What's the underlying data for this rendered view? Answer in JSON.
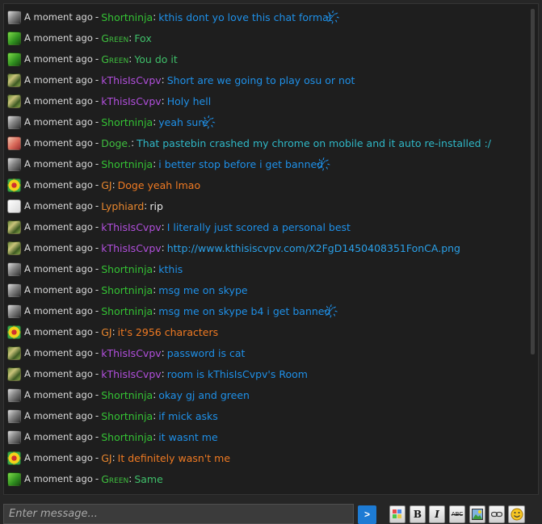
{
  "colors": {
    "timestamp": "#d9d9d9",
    "shortninja": "#34c234",
    "green": "#3fbf3f",
    "kthisiscvpv": "#b14fdc",
    "doge": "#3fbf3f",
    "gj": "#e8872e",
    "lyphiard": "#e8872e",
    "msg_blue": "#1e90e8",
    "msg_cyan": "#2fb7c6",
    "msg_green": "#3fbf6a",
    "msg_orange": "#f07a22",
    "msg_white": "#e8e8e8",
    "msg_link": "#2aa0e8"
  },
  "messages": [
    {
      "avatar": "gray",
      "time": "A moment ago",
      "user": "Shortninja",
      "smallcaps": false,
      "user_color": "#34c234",
      "text": "kthis dont yo love this chat format ̸҉",
      "text_color": "#1e90e8"
    },
    {
      "avatar": "green",
      "time": "A moment ago",
      "user": "Green",
      "smallcaps": true,
      "user_color": "#3fbf3f",
      "text": "Fox",
      "text_color": "#3fbf6a"
    },
    {
      "avatar": "green",
      "time": "A moment ago",
      "user": "Green",
      "smallcaps": true,
      "user_color": "#3fbf3f",
      "text": "You do it",
      "text_color": "#3fbf6a"
    },
    {
      "avatar": "camo",
      "time": "A moment ago",
      "user": "kThisIsCvpv",
      "smallcaps": false,
      "user_color": "#b14fdc",
      "text": "Short are we going to play osu or not",
      "text_color": "#1e90e8"
    },
    {
      "avatar": "camo",
      "time": "A moment ago",
      "user": "kThisIsCvpv",
      "smallcaps": false,
      "user_color": "#b14fdc",
      "text": "Holy hell",
      "text_color": "#1e90e8"
    },
    {
      "avatar": "gray",
      "time": "A moment ago",
      "user": "Shortninja",
      "smallcaps": false,
      "user_color": "#34c234",
      "text": "yeah sure ̸҉",
      "text_color": "#1e90e8"
    },
    {
      "avatar": "pink",
      "time": "A moment ago",
      "user": "Doge.",
      "smallcaps": false,
      "user_color": "#3fbf3f",
      "text": "That pastebin crashed my chrome on mobile and it auto re-installed :/",
      "text_color": "#2fb7c6"
    },
    {
      "avatar": "gray",
      "time": "A moment ago",
      "user": "Shortninja",
      "smallcaps": false,
      "user_color": "#34c234",
      "text": "i better stop before i get banned ̸҉",
      "text_color": "#1e90e8"
    },
    {
      "avatar": "yellow",
      "time": "A moment ago",
      "user": "GJ",
      "smallcaps": false,
      "user_color": "#e8872e",
      "text": "Doge yeah lmao",
      "text_color": "#f07a22"
    },
    {
      "avatar": "white",
      "time": "A moment ago",
      "user": "Lyphiard",
      "smallcaps": false,
      "user_color": "#e8872e",
      "text": "rip",
      "text_color": "#e8e8e8"
    },
    {
      "avatar": "camo",
      "time": "A moment ago",
      "user": "kThisIsCvpv",
      "smallcaps": false,
      "user_color": "#b14fdc",
      "text": "I literally just scored a personal best",
      "text_color": "#1e90e8"
    },
    {
      "avatar": "camo",
      "time": "A moment ago",
      "user": "kThisIsCvpv",
      "smallcaps": false,
      "user_color": "#b14fdc",
      "text": "http://www.kthisiscvpv.com/X2FgD1450408351FonCA.png",
      "text_color": "#2aa0e8"
    },
    {
      "avatar": "gray",
      "time": "A moment ago",
      "user": "Shortninja",
      "smallcaps": false,
      "user_color": "#34c234",
      "text": "kthis",
      "text_color": "#1e90e8"
    },
    {
      "avatar": "gray",
      "time": "A moment ago",
      "user": "Shortninja",
      "smallcaps": false,
      "user_color": "#34c234",
      "text": "msg me on skype",
      "text_color": "#1e90e8"
    },
    {
      "avatar": "gray",
      "time": "A moment ago",
      "user": "Shortninja",
      "smallcaps": false,
      "user_color": "#34c234",
      "text": "msg me on skype b4 i get banned ̸҉",
      "text_color": "#1e90e8"
    },
    {
      "avatar": "yellow",
      "time": "A moment ago",
      "user": "GJ",
      "smallcaps": false,
      "user_color": "#e8872e",
      "text": "it's 2956 characters",
      "text_color": "#f07a22"
    },
    {
      "avatar": "camo",
      "time": "A moment ago",
      "user": "kThisIsCvpv",
      "smallcaps": false,
      "user_color": "#b14fdc",
      "text": "password is cat",
      "text_color": "#1e90e8"
    },
    {
      "avatar": "camo",
      "time": "A moment ago",
      "user": "kThisIsCvpv",
      "smallcaps": false,
      "user_color": "#b14fdc",
      "text": "room is kThisIsCvpv's Room",
      "text_color": "#1e90e8"
    },
    {
      "avatar": "gray",
      "time": "A moment ago",
      "user": "Shortninja",
      "smallcaps": false,
      "user_color": "#34c234",
      "text": "okay gj and green",
      "text_color": "#1e90e8"
    },
    {
      "avatar": "gray",
      "time": "A moment ago",
      "user": "Shortninja",
      "smallcaps": false,
      "user_color": "#34c234",
      "text": "if mick asks",
      "text_color": "#1e90e8"
    },
    {
      "avatar": "gray",
      "time": "A moment ago",
      "user": "Shortninja",
      "smallcaps": false,
      "user_color": "#34c234",
      "text": "it wasnt me",
      "text_color": "#1e90e8"
    },
    {
      "avatar": "yellow",
      "time": "A moment ago",
      "user": "GJ",
      "smallcaps": false,
      "user_color": "#e8872e",
      "text": "It definitely wasn't me",
      "text_color": "#f07a22"
    },
    {
      "avatar": "green",
      "time": "A moment ago",
      "user": "Green",
      "smallcaps": true,
      "user_color": "#3fbf3f",
      "text": "Same",
      "text_color": "#3fbf6a"
    }
  ],
  "composer": {
    "placeholder": "Enter message...",
    "send_label": ">"
  },
  "toolbar": {
    "color_icon": "color-palette-icon",
    "bold_label": "B",
    "italic_label": "I",
    "strike_label": "ABC",
    "image_icon": "image-icon",
    "link_icon": "link-icon",
    "emoji_icon": "smiley-icon"
  }
}
